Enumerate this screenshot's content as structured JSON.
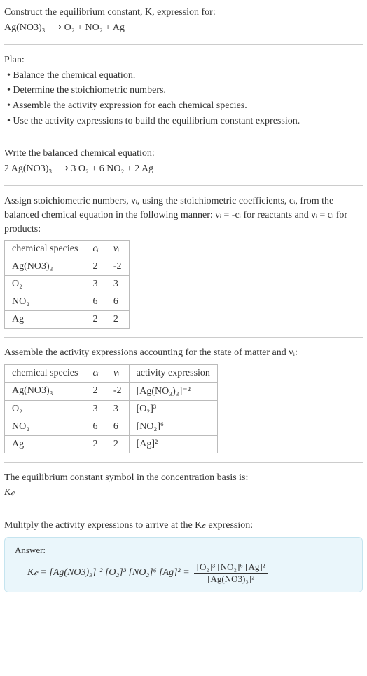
{
  "intro": {
    "line1": "Construct the equilibrium constant, K, expression for:",
    "equation": "Ag(NO3)₃ ⟶ O₂ + NO₂ + Ag"
  },
  "plan": {
    "title": "Plan:",
    "b1": "• Balance the chemical equation.",
    "b2": "• Determine the stoichiometric numbers.",
    "b3": "• Assemble the activity expression for each chemical species.",
    "b4": "• Use the activity expressions to build the equilibrium constant expression."
  },
  "balanced": {
    "title": "Write the balanced chemical equation:",
    "equation": "2 Ag(NO3)₃ ⟶ 3 O₂ + 6 NO₂ + 2 Ag"
  },
  "assign": {
    "text": "Assign stoichiometric numbers, νᵢ, using the stoichiometric coefficients, cᵢ, from the balanced chemical equation in the following manner: νᵢ = -cᵢ for reactants and νᵢ = cᵢ for products:",
    "headers": {
      "h1": "chemical species",
      "h2": "cᵢ",
      "h3": "νᵢ"
    },
    "rows": [
      {
        "s": "Ag(NO3)₃",
        "c": "2",
        "v": "-2"
      },
      {
        "s": "O₂",
        "c": "3",
        "v": "3"
      },
      {
        "s": "NO₂",
        "c": "6",
        "v": "6"
      },
      {
        "s": "Ag",
        "c": "2",
        "v": "2"
      }
    ]
  },
  "activity": {
    "text": "Assemble the activity expressions accounting for the state of matter and νᵢ:",
    "headers": {
      "h1": "chemical species",
      "h2": "cᵢ",
      "h3": "νᵢ",
      "h4": "activity expression"
    },
    "rows": [
      {
        "s": "Ag(NO3)₃",
        "c": "2",
        "v": "-2",
        "a": "[Ag(NO₃)₃]⁻²"
      },
      {
        "s": "O₂",
        "c": "3",
        "v": "3",
        "a": "[O₂]³"
      },
      {
        "s": "NO₂",
        "c": "6",
        "v": "6",
        "a": "[NO₂]⁶"
      },
      {
        "s": "Ag",
        "c": "2",
        "v": "2",
        "a": "[Ag]²"
      }
    ]
  },
  "eqconst": {
    "text": "The equilibrium constant symbol in the concentration basis is:",
    "symbol": "K𝒸"
  },
  "multiply": {
    "text": "Mulitply the activity expressions to arrive at the K𝒸 expression:"
  },
  "answer": {
    "label": "Answer:",
    "lhs": "K𝒸 = [Ag(NO3)₃]⁻² [O₂]³ [NO₂]⁶ [Ag]² =",
    "num": "[O₂]³ [NO₂]⁶ [Ag]²",
    "den": "[Ag(NO3)₃]²"
  }
}
